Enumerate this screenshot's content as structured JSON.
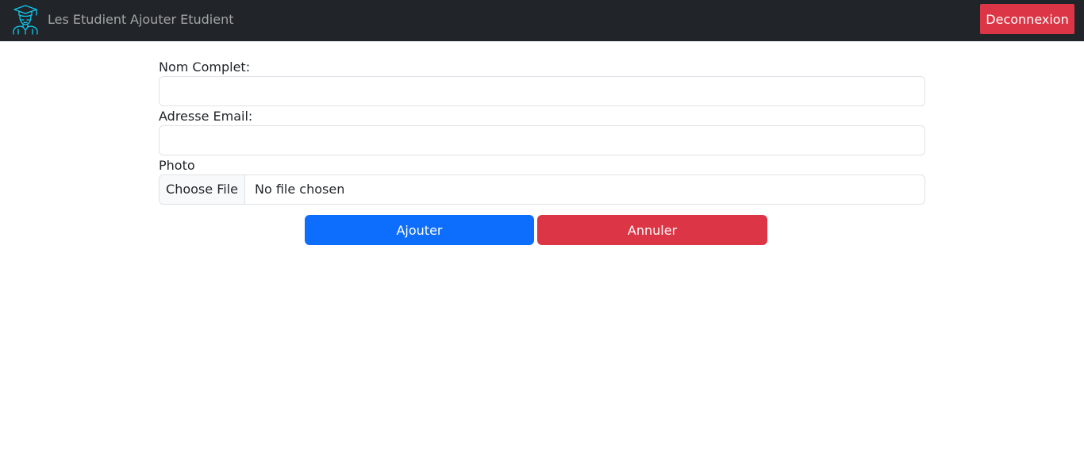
{
  "navbar": {
    "logo_icon": "graduate-student-icon",
    "links": [
      "Les Etudient",
      "Ajouter Etudient"
    ],
    "logout_label": "Deconnexion",
    "bg_color": "#212529",
    "logo_color": "#0dcaf0"
  },
  "form": {
    "name_label": "Nom Complet:",
    "name_value": "",
    "email_label": "Adresse Email:",
    "email_value": "",
    "photo_label": "Photo",
    "file_button": "Choose File",
    "file_status": "No file chosen"
  },
  "actions": {
    "add_label": "Ajouter",
    "cancel_label": "Annuler",
    "add_color": "#0d6efd",
    "cancel_color": "#dc3545"
  }
}
